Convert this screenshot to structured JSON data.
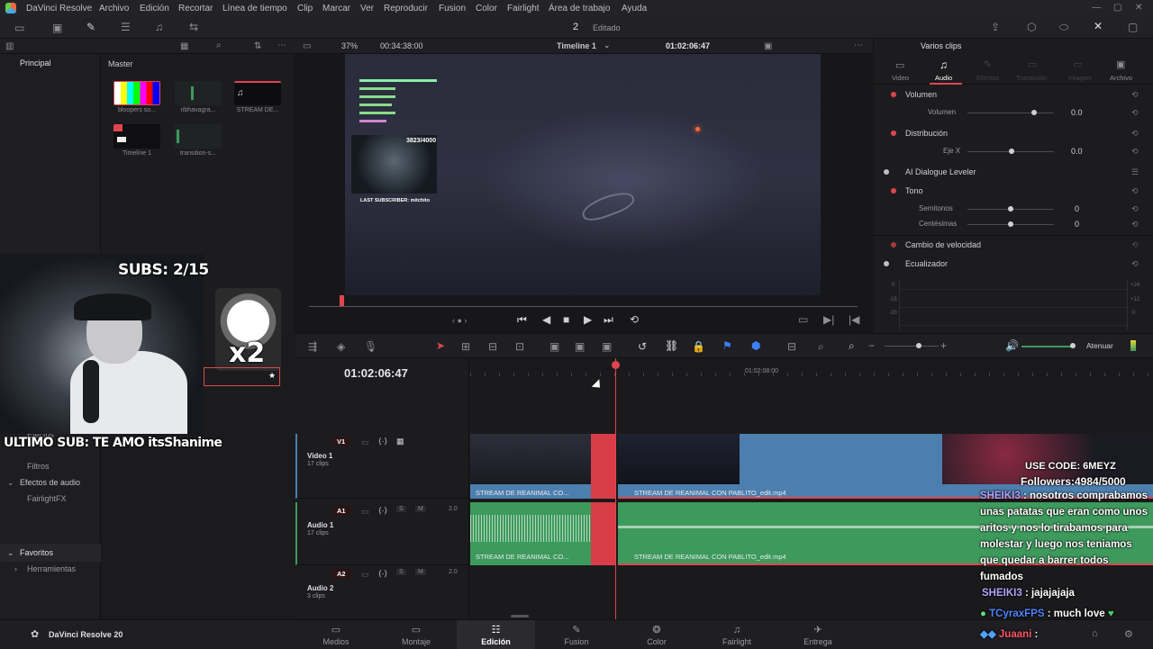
{
  "menu": {
    "app": "DaVinci Resolve",
    "items": [
      "Archivo",
      "Edición",
      "Recortar",
      "Línea de tiempo",
      "Clip",
      "Marcar",
      "Ver",
      "Reproducir",
      "Fusion",
      "Color",
      "Fairlight",
      "Área de trabajo",
      "Ayuda"
    ]
  },
  "project": {
    "number": "2",
    "status": "Editado"
  },
  "viewer_bar": {
    "zoom": "37%",
    "duration": "00:34:38:00",
    "timeline_name": "Timeline 1",
    "timecode": "01:02:06:47"
  },
  "inspector": {
    "title": "Varios clips",
    "tabs": [
      "Video",
      "Audio",
      "Efectos",
      "Transición",
      "Imagen",
      "Archivo"
    ],
    "active_tab": "Audio",
    "sections": {
      "volume": {
        "label": "Volumen",
        "param": "Volumen",
        "value": "0.0"
      },
      "pan": {
        "label": "Distribución",
        "param": "Eje X",
        "value": "0.0"
      },
      "dialogue": {
        "label": "AI Dialogue Leveler"
      },
      "pitch": {
        "label": "Tono",
        "semitones_label": "Semitonos",
        "semitones": "0",
        "cents_label": "Centésimas",
        "cents": "0"
      },
      "speed": {
        "label": "Cambio de velocidad"
      },
      "eq": {
        "label": "Ecualizador",
        "ticks": [
          "0",
          "-15",
          "-20",
          "+24",
          "+12",
          "0"
        ]
      }
    }
  },
  "left_panel": {
    "tab": "Principal",
    "effects_items": [
      "Efectos",
      "Filtros",
      "Efectos de audio",
      "FairlightFX"
    ],
    "favorites": "Favoritos",
    "tools": "Herramientas"
  },
  "media_pool": {
    "title": "Master",
    "clips": [
      "bloopers so...",
      "ribhavagra...",
      "STREAM DE...",
      "Timeline 1",
      "transition-s..."
    ]
  },
  "timeline": {
    "timecode": "01:02:06:47",
    "ruler_label": "01:02:08:00",
    "attenuate": "Atenuar",
    "tracks": [
      {
        "id": "V1",
        "name": "Video 1",
        "clips": "17 clips"
      },
      {
        "id": "A1",
        "name": "Audio 1",
        "clips": "17 clips",
        "level": "2.0"
      },
      {
        "id": "A2",
        "name": "Audio 2",
        "clips": "3 clips",
        "level": "2.0"
      }
    ],
    "clip_names": [
      "STREAM DE REANIMAL CO...",
      "STREAM DE REANIMAL CON PABLITO_edit.mp4",
      "STREAM DE REANIMAL CO...",
      "STREAM DE REANIMAL CON PABLITO_edit.mp4"
    ]
  },
  "pages": [
    "Medios",
    "Montaje",
    "Edición",
    "Fusion",
    "Color",
    "Fairlight",
    "Entrega"
  ],
  "active_page": "Edición",
  "brand": "DaVinci Resolve 20",
  "stream_overlay": {
    "subs": "SUBS: 2/15",
    "multiplier": "x2",
    "last_sub": "ULTIMO SUB: TE AMO itsShanime",
    "use_code": "USE CODE: 6MEYZ",
    "followers": "Followers:4984/5000",
    "inner_counter": "3823/4000",
    "inner_last": "LAST SUBSCRIBER: mitchito",
    "chat": [
      {
        "user": "SHEIKI3",
        "text": "nosotros comprabamos unas patatas que eran como unos aritos y nos lo tirabamos para molestar y luego nos teniamos que quedar a barrer todos fumados"
      },
      {
        "user": "SHEIKI3",
        "text": "jajajajaja"
      },
      {
        "user": "TCyraxFPS",
        "text": "much love"
      },
      {
        "user": "Juaani",
        "text": ""
      }
    ]
  },
  "colors": {
    "accent": "#e0454f",
    "video_clip": "#4c7fae",
    "audio_clip": "#3d9a5c",
    "playhead": "#e0454f"
  }
}
